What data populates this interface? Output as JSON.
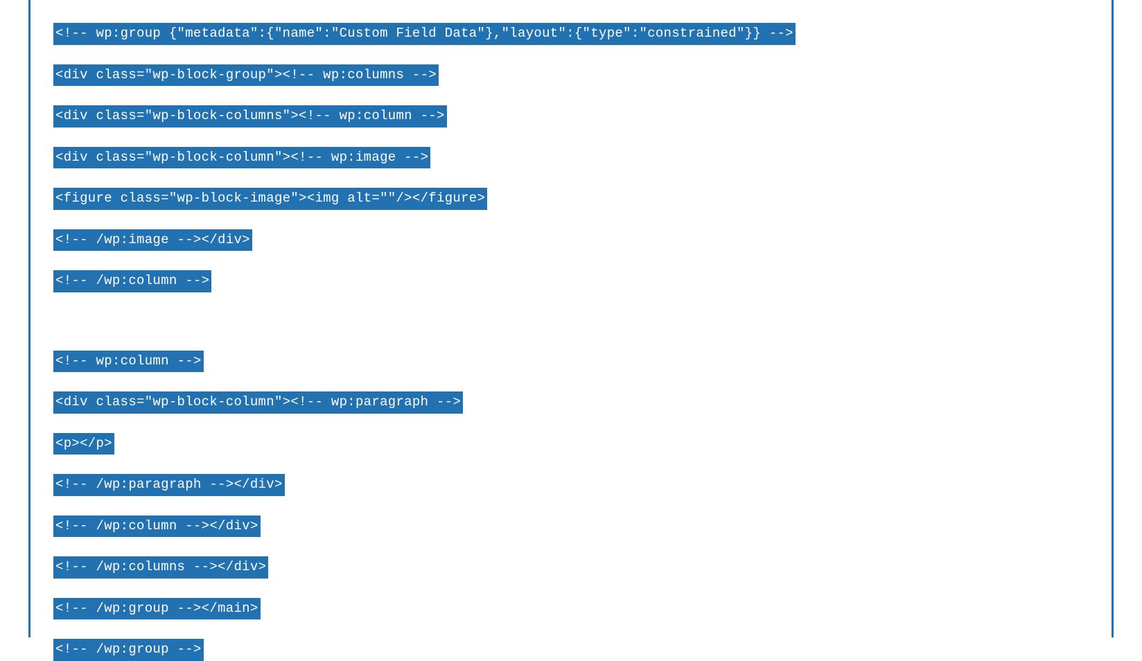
{
  "code": {
    "lines": [
      "<!-- wp:group {\"metadata\":{\"name\":\"Custom Field Data\"},\"layout\":{\"type\":\"constrained\"}} -->",
      "<div class=\"wp-block-group\"><!-- wp:columns -->",
      "<div class=\"wp-block-columns\"><!-- wp:column -->",
      "<div class=\"wp-block-column\"><!-- wp:image -->",
      "<figure class=\"wp-block-image\"><img alt=\"\"/></figure>",
      "<!-- /wp:image --></div>",
      "<!-- /wp:column -->",
      "",
      "<!-- wp:column -->",
      "<div class=\"wp-block-column\"><!-- wp:paragraph -->",
      "<p></p>",
      "<!-- /wp:paragraph --></div>",
      "<!-- /wp:column --></div>",
      "<!-- /wp:columns --></div>",
      "<!-- /wp:group --></main>",
      "<!-- /wp:group -->"
    ]
  }
}
